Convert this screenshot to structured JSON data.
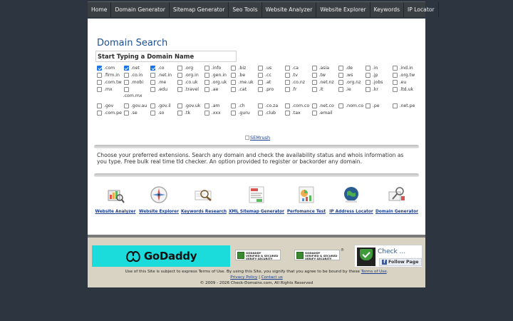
{
  "nav": {
    "items": [
      "Home",
      "Domain Generator",
      "Sitemap Generator",
      "Seo Tools",
      "Website Analyzer",
      "Website Explorer",
      "Keywords",
      "IP Locator"
    ]
  },
  "main": {
    "title": "Domain Search",
    "search_placeholder": "Start Typing a Domain Name",
    "tld_rows": [
      [
        ".com",
        ".net",
        ".co",
        ".org",
        ".info",
        ".biz",
        ".us",
        ".ca",
        ".asia",
        ".de",
        ".in",
        ".ind.in"
      ],
      [
        ".firm.in",
        ".co.in",
        ".net.in",
        ".org.in",
        ".gen.in",
        ".be",
        ".cc",
        ".tv",
        ".tw",
        ".ws",
        ".jp",
        ".org.tw"
      ],
      [
        ".com.tw",
        ".mobi",
        ".me",
        ".co.uk",
        ".org.uk",
        ".me.uk",
        ".at",
        ".co.nz",
        ".net.nz",
        ".org.nz",
        ".jobs",
        ".eu"
      ],
      [
        ".mx",
        ".com.mx",
        ".edu",
        ".travel",
        ".ae",
        ".cat",
        ".pro",
        ".fr",
        ".it",
        ".ie",
        ".kr",
        ".ltd.uk"
      ],
      [
        ".gov",
        ".gov.au",
        ".gov.il",
        ".gov.uk",
        ".am",
        ".ch",
        ".co.za",
        ".com.co",
        ".net.co",
        ".nom.co",
        ".pe",
        ".net.pe"
      ],
      [
        ".com.pe",
        ".se",
        ".so",
        ".tk",
        ".xxx",
        ".guru",
        ".club",
        ".tax",
        ".email"
      ]
    ],
    "checked": [
      ".com",
      ".net",
      ".co"
    ],
    "semrush_alt": "SEMrush",
    "description": "Choose your preferred extensions. Search any domain and check the availability status and whois information as you type. Free bulk real time tld checker. An option provided to register or backorder any domain."
  },
  "tools": [
    {
      "label": "Website Analyzer",
      "icon": "analyzer-icon"
    },
    {
      "label": "Website Explorer",
      "icon": "compass-icon"
    },
    {
      "label": "Keywords Research",
      "icon": "magnifier-icon"
    },
    {
      "label": "XML Sitemap Generator",
      "icon": "sitemap-icon"
    },
    {
      "label": "Perfomance Test",
      "icon": "performance-icon"
    },
    {
      "label": "IP Address Locator",
      "icon": "ip-locator-icon"
    },
    {
      "label": "Domain Generator",
      "icon": "domain-generator-icon"
    }
  ],
  "footer": {
    "godaddy": "GoDaddy",
    "seal_line1": "GODADDY",
    "seal_line2": "VERIFIED & SECURED",
    "seal_line3": "VERIFY SECURITY",
    "widget_title": "Check ...",
    "follow_label": "Follow Page",
    "terms_prefix": "Use of this Site is subject to express Terms of Use. By using this Site, you signify that you agree to be bound by these ",
    "terms_link": "Terms of Use",
    "terms_suffix": ".",
    "privacy_link": "Privacy Policy",
    "separator": " | ",
    "contact_link": "Contact us",
    "copyright": "© 2009 - 2026  Check-Domains.com, All Rights Reserved"
  },
  "colors": {
    "background": "#2d3640",
    "nav": "#3a3f44",
    "title": "#1d4f91",
    "godaddy_bg": "#1bdbdb",
    "footer_bg": "#d8d3c2"
  }
}
